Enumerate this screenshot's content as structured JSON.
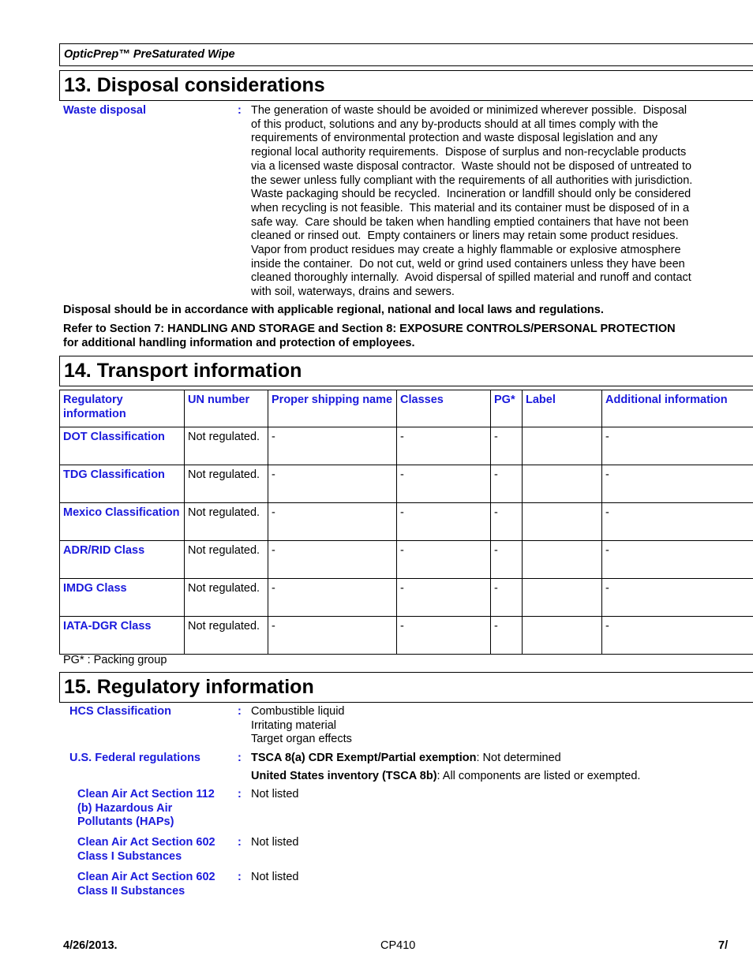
{
  "header": {
    "product_name": "OpticPrep™ PreSaturated Wipe"
  },
  "section13": {
    "title": "13. Disposal considerations",
    "waste_disposal_label": "Waste disposal",
    "waste_disposal_lines": [
      "The generation of waste should be avoided or minimized wherever possible.  Disposal",
      "of this product, solutions and any by-products should at all times comply with the",
      "requirements of environmental protection and waste disposal legislation and any",
      "regional local authority requirements.  Dispose of surplus and non-recyclable products",
      "via a licensed waste disposal contractor.  Waste should not be disposed of untreated to",
      "the sewer unless fully compliant with the requirements of all authorities with jurisdiction.",
      "Waste packaging should be recycled.  Incineration or landfill should only be considered",
      "when recycling is not feasible.  This material and its container must be disposed of in a",
      "safe way.  Care should be taken when handling emptied containers that have not been",
      "cleaned or rinsed out.  Empty containers or liners may retain some product residues.",
      "Vapor from product residues may create a highly flammable or explosive atmosphere",
      "inside the container.  Do not cut, weld or grind used containers unless they have been",
      "cleaned thoroughly internally.  Avoid dispersal of spilled material and runoff and contact",
      "with soil, waterways, drains and sewers."
    ],
    "note1": "Disposal should be in accordance with applicable regional, national and local laws and regulations.",
    "note2_line1": "Refer to Section 7: HANDLING AND STORAGE and Section 8: EXPOSURE CONTROLS/PERSONAL PROTECTION",
    "note2_line2": "for additional handling information and protection of employees."
  },
  "section14": {
    "title": "14. Transport information",
    "columns": [
      "Regulatory information",
      "UN number",
      "Proper shipping name",
      "Classes",
      "PG*",
      "Label",
      "Additional information"
    ],
    "rows": [
      {
        "label": "DOT Classification",
        "un": "Not regulated.",
        "name": "-",
        "classes": "-",
        "pg": "-",
        "labelv": "",
        "additional": "-"
      },
      {
        "label": "TDG Classification",
        "un": "Not regulated.",
        "name": "-",
        "classes": "-",
        "pg": "-",
        "labelv": "",
        "additional": "-"
      },
      {
        "label": "Mexico Classification",
        "un": "Not regulated.",
        "name": "-",
        "classes": "-",
        "pg": "-",
        "labelv": "",
        "additional": "-"
      },
      {
        "label": "ADR/RID Class",
        "un": "Not regulated.",
        "name": "-",
        "classes": "-",
        "pg": "-",
        "labelv": "",
        "additional": "-"
      },
      {
        "label": "IMDG Class",
        "un": "Not regulated.",
        "name": "-",
        "classes": "-",
        "pg": "-",
        "labelv": "",
        "additional": "-"
      },
      {
        "label": "IATA-DGR Class",
        "un": "Not regulated.",
        "name": "-",
        "classes": "-",
        "pg": "-",
        "labelv": "",
        "additional": "-"
      }
    ],
    "footnote": "PG* : Packing group"
  },
  "section15": {
    "title": "15. Regulatory information",
    "hcs_label": "HCS Classification",
    "hcs_values": [
      "Combustible liquid",
      "Irritating material",
      "Target organ effects"
    ],
    "federal_label": "U.S. Federal regulations",
    "tsca8a_label": "TSCA 8(a) CDR Exempt/Partial exemption",
    "tsca8a_value": ": Not determined",
    "tsca8b_label": "United States inventory (TSCA 8b)",
    "tsca8b_value": ": All components are listed or exempted.",
    "caa112_label_lines": [
      "Clean Air Act  Section 112",
      "(b) Hazardous Air",
      "Pollutants (HAPs)"
    ],
    "caa112_value": "Not listed",
    "caa602_1_label_lines": [
      "Clean Air Act Section 602",
      "Class I Substances"
    ],
    "caa602_1_value": "Not listed",
    "caa602_2_label_lines": [
      "Clean Air Act Section 602",
      "Class II Substances"
    ],
    "caa602_2_value": "Not listed",
    "colon": ":"
  },
  "footer": {
    "date": "4/26/2013.",
    "code": "CP410",
    "page": "7/"
  }
}
